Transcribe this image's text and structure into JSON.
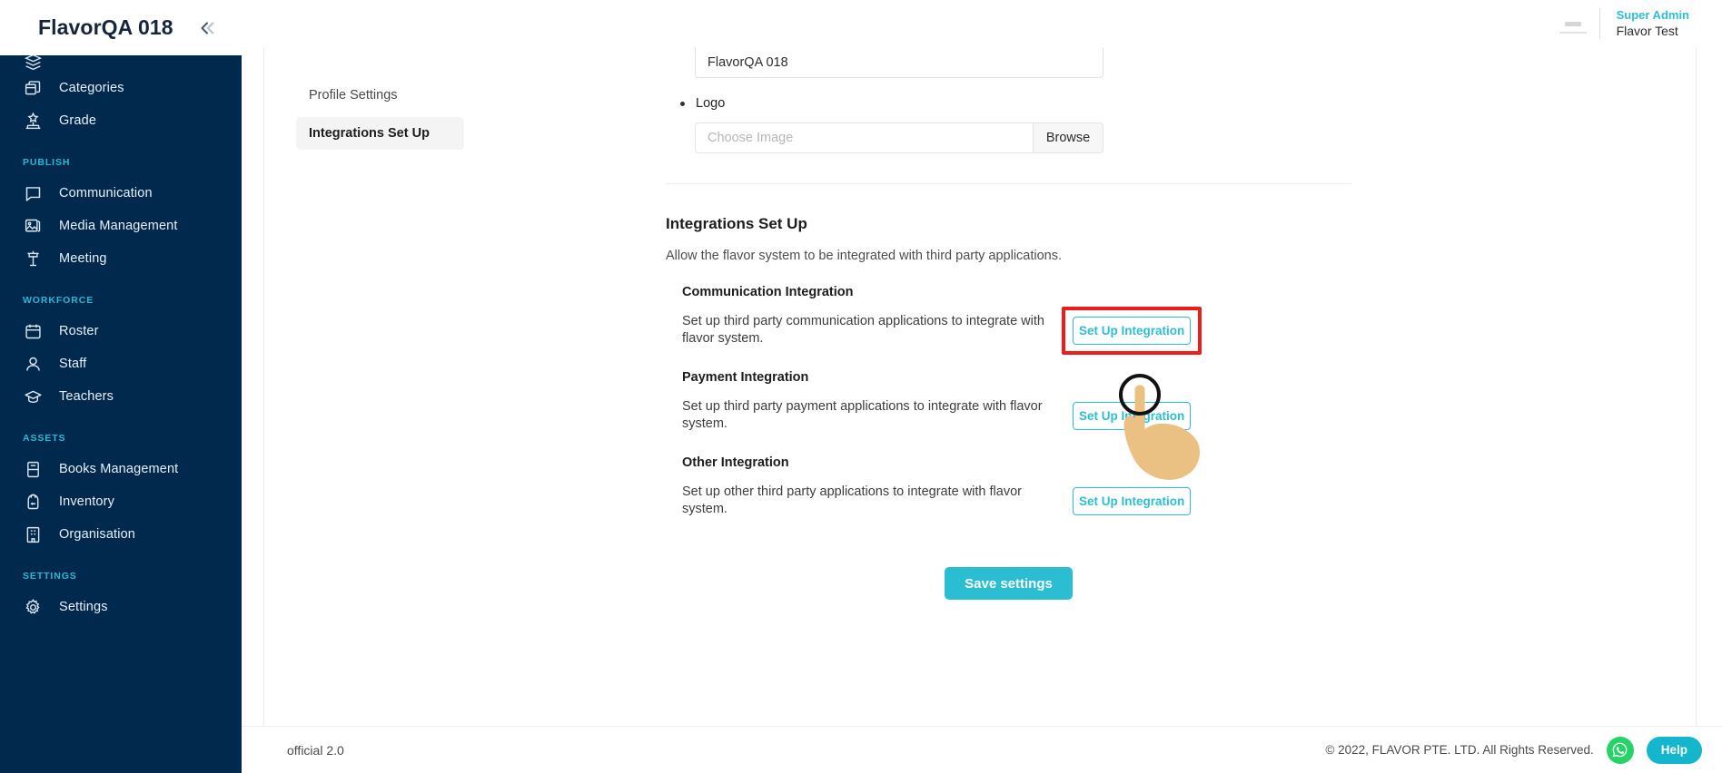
{
  "theme": {
    "sidebar_bg": "#00294d",
    "accent_cyan": "#2bbfd4",
    "section_header": "#2bb8d6",
    "highlight_red": "#f01c1c",
    "whatsapp_green": "#25d366"
  },
  "header": {
    "brand_title": "FlavorQA 018",
    "collapse_icon": "chevron-double-left-icon"
  },
  "topbar": {
    "user_role": "Super Admin",
    "user_name": "Flavor Test",
    "avatar_icon": "broken-image-avatar-icon"
  },
  "sidebar": {
    "groups": [
      {
        "section": null,
        "items": [
          {
            "label": "",
            "icon": "clipped-item-icon",
            "clipped": true
          },
          {
            "label": "Categories",
            "icon": "categories-icon"
          },
          {
            "label": "Grade",
            "icon": "grade-icon"
          }
        ]
      },
      {
        "section": "PUBLISH",
        "items": [
          {
            "label": "Communication",
            "icon": "chat-icon"
          },
          {
            "label": "Media Management",
            "icon": "media-icon"
          },
          {
            "label": "Meeting",
            "icon": "podium-icon"
          }
        ]
      },
      {
        "section": "WORKFORCE",
        "items": [
          {
            "label": "Roster",
            "icon": "calendar-icon"
          },
          {
            "label": "Staff",
            "icon": "user-icon"
          },
          {
            "label": "Teachers",
            "icon": "graduation-cap-icon"
          }
        ]
      },
      {
        "section": "ASSETS",
        "items": [
          {
            "label": "Books Management",
            "icon": "book-icon"
          },
          {
            "label": "Inventory",
            "icon": "backpack-icon"
          },
          {
            "label": "Organisation",
            "icon": "building-icon"
          }
        ]
      },
      {
        "section": "SETTINGS",
        "items": [
          {
            "label": "Settings",
            "icon": "gear-icon"
          }
        ]
      }
    ]
  },
  "tabs": [
    {
      "label": "Profile Settings",
      "active": false
    },
    {
      "label": "Integrations Set Up",
      "active": true
    }
  ],
  "profile_form": {
    "name_value": "FlavorQA 018",
    "logo_label": "Logo",
    "logo_placeholder": "Choose Image",
    "logo_value": "",
    "browse_label": "Browse"
  },
  "integrations": {
    "title": "Integrations Set Up",
    "subtitle": "Allow the flavor system to be integrated with third party applications.",
    "items": [
      {
        "title": "Communication Integration",
        "description": "Set up third party communication applications to integrate with flavor system.",
        "button_label": "Set Up Integration",
        "highlighted": true
      },
      {
        "title": "Payment Integration",
        "description": "Set up third party payment applications to integrate with flavor system.",
        "button_label": "Set Up Integration",
        "highlighted": false
      },
      {
        "title": "Other Integration",
        "description": "Set up other third party applications to integrate with flavor system.",
        "button_label": "Set Up Integration",
        "highlighted": false
      }
    ],
    "save_label": "Save settings"
  },
  "footer": {
    "version": "official 2.0",
    "copyright": "© 2022, FLAVOR PTE. LTD. All Rights Reserved.",
    "whatsapp_icon": "whatsapp-icon",
    "help_label": "Help"
  },
  "cursor": {
    "type": "pointing-hand-cursor",
    "click_indicator": "click-circle"
  }
}
